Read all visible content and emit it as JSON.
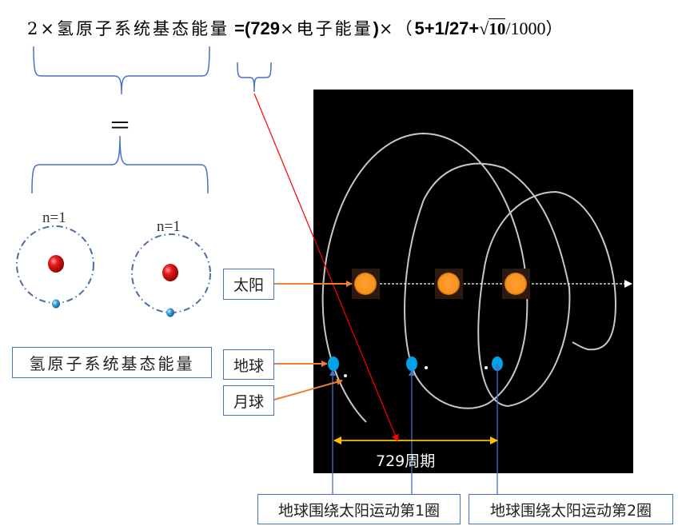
{
  "formula": {
    "lhs_coef": "2×",
    "lhs_term": "氢原子系统基态能量",
    "rhs_open": " =(729",
    "rhs_times": "×",
    "rhs_term": "电子能量",
    "rhs_close": ")",
    "times2": "×",
    "paren_open": "（",
    "sum_part": "5+1/27+",
    "sqrt_symbol": "√",
    "sqrt_arg": "10",
    "divisor": "/1000",
    "paren_close": "）"
  },
  "equal_sign": "＝",
  "atoms": [
    {
      "orbit_label": "n=1"
    },
    {
      "orbit_label": "n=1"
    }
  ],
  "hydrogen_label": "氢原子系统基态能量",
  "callouts": {
    "sun": "太阳",
    "earth": "地球",
    "moon": "月球"
  },
  "period_label": "729周期",
  "orbit_boxes": [
    "地球围绕太阳运动第1圈",
    "地球围绕太阳运动第2圈"
  ],
  "colors": {
    "brace": "#4472c4",
    "callout_arrow": "#ed7d31",
    "red_pointer": "#ff0000",
    "period_arrow": "#ffc000",
    "panel_bg": "#000000",
    "sun": "#f7931e",
    "earth": "#00a2e8",
    "proton": "#e00000",
    "electron": "#3a9ad9"
  }
}
